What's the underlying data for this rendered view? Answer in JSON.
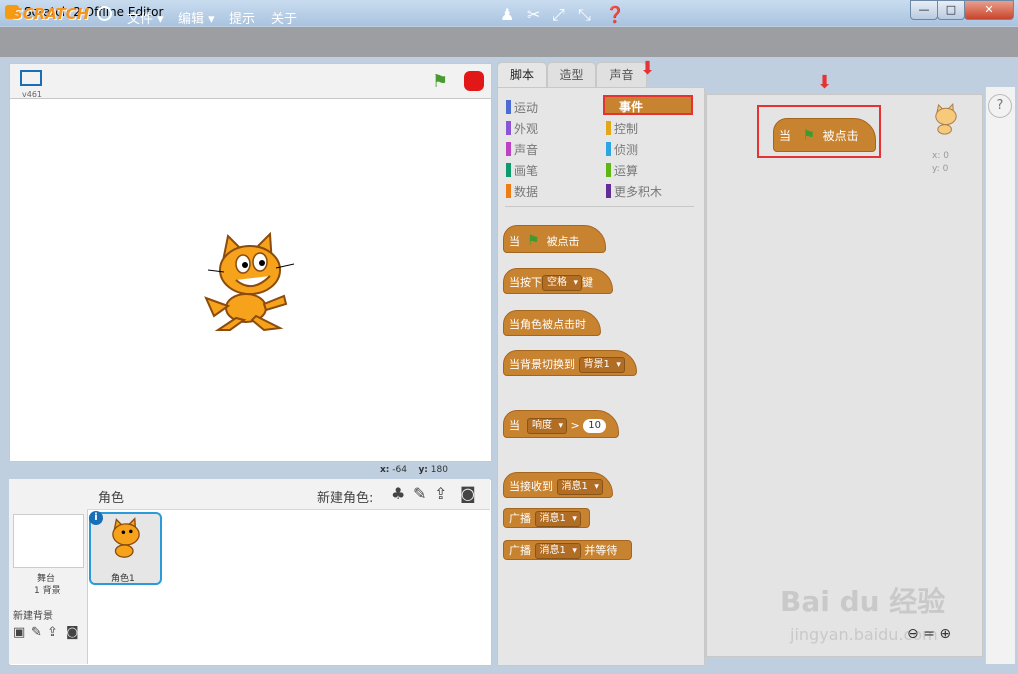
{
  "window": {
    "title": "Scratch 2 Offline Editor",
    "min": "—",
    "max": "□",
    "close": "✕"
  },
  "menu": {
    "logo": "SCRATCH",
    "file": "文件 ▾",
    "edit": "编辑 ▾",
    "tips": "提示",
    "about": "关于"
  },
  "stage": {
    "version": "v461",
    "x_label": "x:",
    "x_val": "-64",
    "y_label": "y:",
    "y_val": "180"
  },
  "sprites": {
    "label": "角色",
    "new_sprite": "新建角色:",
    "stage_name": "舞台",
    "backdrop_count": "1 背景",
    "new_backdrop": "新建背景",
    "sprite1": "角色1"
  },
  "tabs": {
    "scripts": "脚本",
    "costumes": "造型",
    "sounds": "声音"
  },
  "categories": [
    {
      "label": "运动",
      "color": "#4a6cd4"
    },
    {
      "label": "外观",
      "color": "#8a55d7"
    },
    {
      "label": "声音",
      "color": "#bb42c3"
    },
    {
      "label": "画笔",
      "color": "#0e9a6c"
    },
    {
      "label": "数据",
      "color": "#ee7d16"
    },
    {
      "label": "事件",
      "color": "#c88330"
    },
    {
      "label": "控制",
      "color": "#e1a91a"
    },
    {
      "label": "侦测",
      "color": "#2ca5e2"
    },
    {
      "label": "运算",
      "color": "#5cb712"
    },
    {
      "label": "更多积木",
      "color": "#632d99"
    }
  ],
  "blocks": {
    "when_flag": {
      "a": "当",
      "b": "被点击"
    },
    "when_key": {
      "a": "当按下",
      "key": "空格",
      "b": "键"
    },
    "when_sprite_clicked": "当角色被点击时",
    "when_backdrop": {
      "a": "当背景切换到",
      "dd": "背景1"
    },
    "when_sensor": {
      "a": "当",
      "dd": "响度",
      "op": ">",
      "val": "10"
    },
    "when_receive": {
      "a": "当接收到",
      "dd": "消息1"
    },
    "broadcast": {
      "a": "广播",
      "dd": "消息1"
    },
    "broadcast_wait": {
      "a": "广播",
      "dd": "消息1",
      "b": "并等待"
    }
  },
  "script": {
    "a": "当",
    "b": "被点击",
    "x_label": "x: 0",
    "y_label": "y: 0"
  },
  "watermark": {
    "main": "Bai du 经验",
    "sub": "jingyan.baidu.com"
  }
}
